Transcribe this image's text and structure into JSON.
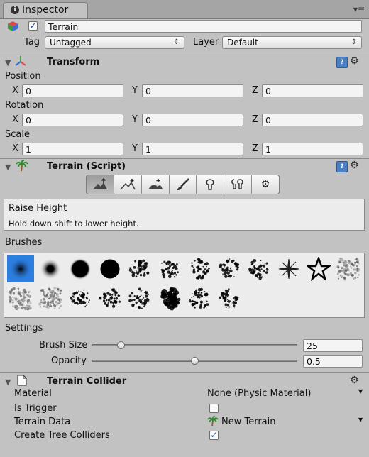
{
  "tab": {
    "title": "Inspector",
    "menu_glyph": "▾≡"
  },
  "object": {
    "name": "Terrain",
    "active": true
  },
  "tag": {
    "label": "Tag",
    "value": "Untagged"
  },
  "layer": {
    "label": "Layer",
    "value": "Default"
  },
  "transform": {
    "title": "Transform",
    "position": {
      "label": "Position",
      "x": "0",
      "y": "0",
      "z": "0"
    },
    "rotation": {
      "label": "Rotation",
      "x": "0",
      "y": "0",
      "z": "0"
    },
    "scale": {
      "label": "Scale",
      "x": "1",
      "y": "1",
      "z": "1"
    }
  },
  "axes": {
    "x": "X",
    "y": "Y",
    "z": "Z"
  },
  "terrain_script": {
    "title": "Terrain (Script)",
    "tools": [
      "raise-lower-height-icon",
      "paint-height-icon",
      "smooth-height-icon",
      "paint-texture-icon",
      "place-trees-icon",
      "paint-details-icon",
      "terrain-settings-icon"
    ],
    "selected_tool": 0,
    "tool_name": "Raise Height",
    "tool_hint": "Hold down shift to lower height.",
    "brushes_label": "Brushes",
    "brush_count": 20,
    "selected_brush": 0,
    "settings_label": "Settings",
    "brush_size": {
      "label": "Brush Size",
      "value": "25",
      "fraction": 0.14
    },
    "opacity": {
      "label": "Opacity",
      "value": "0.5",
      "fraction": 0.5
    }
  },
  "terrain_collider": {
    "title": "Terrain Collider",
    "material": {
      "label": "Material",
      "value": "None (Physic Material)"
    },
    "is_trigger": {
      "label": "Is Trigger",
      "checked": false
    },
    "terrain_data": {
      "label": "Terrain Data",
      "value": "New Terrain"
    },
    "create_tree_colliders": {
      "label": "Create Tree Colliders",
      "checked": true
    }
  },
  "colors": {
    "panel": "#c2c2c2",
    "selected_brush": "#2c7ee0",
    "help_icon": "#4b7fc2"
  }
}
